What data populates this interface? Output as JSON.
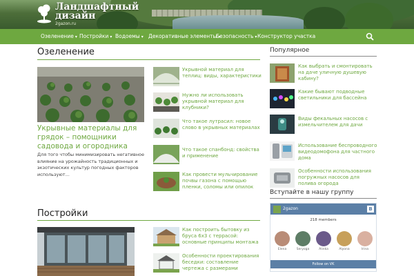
{
  "site": {
    "title_line1": "Ландшафтный",
    "title_line2": "дизайн",
    "subtitle": "2gazon.ru"
  },
  "nav": [
    {
      "label": "Озеленение"
    },
    {
      "label": "Постройки"
    },
    {
      "label": "Водоемы"
    },
    {
      "label": "Декоративные элементы"
    },
    {
      "label": "Безопасность"
    },
    {
      "label": "Конструктор участка"
    }
  ],
  "sections": {
    "greening": {
      "title": "Озеленение",
      "featured": {
        "caption": "Укрывные материалы для грядок – помощники садовода и огородника",
        "desc": "Для того чтобы минимизировать негативное влияние на урожайность традиционных и экзотических культур погодных факторов используют..."
      },
      "items": [
        "Укрывной материал для теплиц: виды, характеристики",
        "Нужно ли использовать укрывной материал для клубники?",
        "Что такое лутрасил: новое слово в укрывных материалах",
        "Что такое спанбонд: свойства и применение",
        "Как провести мульчирование почвы газона с помощью пленки, соломы или опилок"
      ]
    },
    "buildings": {
      "title": "Постройки",
      "items": [
        "Как построить бытовку из бруса 6х3 с террасой: основные принципы монтажа",
        "Особенности проектирования беседки: составление чертежа с размерами"
      ]
    }
  },
  "sidebar": {
    "popular_title": "Популярное",
    "popular": [
      "Как выбрать и смонтировать на даче уличную душевую кабину?",
      "Какие бывают подводные светильники для бассейна",
      "Виды фекальных насосов с измельчителем для дачи",
      "Использование беспроводного видеодомофона для частного дома",
      "Особенности использования погружных насосов для полива огорода"
    ],
    "group_title": "Вступайте в нашу группу",
    "vk": {
      "name": "2gazon",
      "logo": "В",
      "members": "218 members",
      "faces": [
        "Elena",
        "Seryoga",
        "Alinka",
        "Alyona",
        "Irina"
      ],
      "follow": "Follow on VK"
    }
  }
}
